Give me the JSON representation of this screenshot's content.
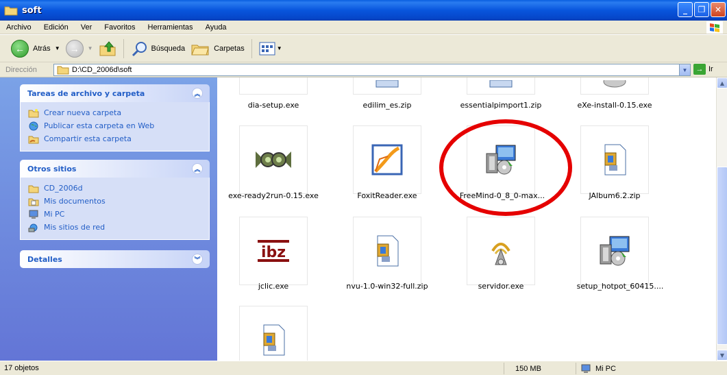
{
  "window": {
    "title": "soft",
    "folder_icon": "folder-icon",
    "buttons": [
      "minimize-icon",
      "restore-icon",
      "close-icon"
    ]
  },
  "menu": [
    "Archivo",
    "Edición",
    "Ver",
    "Favoritos",
    "Herramientas",
    "Ayuda"
  ],
  "toolbar": {
    "back_label": "Atrás",
    "search_label": "Búsqueda",
    "folders_label": "Carpetas"
  },
  "address": {
    "label": "Dirección",
    "path": "D:\\CD_2006d\\soft",
    "go_label": "Ir"
  },
  "left_panel": {
    "tasks": {
      "title": "Tareas de archivo y carpeta",
      "items": [
        "Crear nueva carpeta",
        "Publicar esta carpeta en Web",
        "Compartir esta carpeta"
      ]
    },
    "other_places": {
      "title": "Otros sitios",
      "items": [
        "CD_2006d",
        "Mis documentos",
        "Mi PC",
        "Mis sitios de red"
      ]
    },
    "details": {
      "title": "Detalles"
    }
  },
  "files": [
    {
      "name": "dia-setup.exe",
      "icon": "dia-icon"
    },
    {
      "name": "edilim_es.zip",
      "icon": "zip-icon"
    },
    {
      "name": "essentialpimport1.zip",
      "icon": "zip-icon"
    },
    {
      "name": "eXe-install-0.15.exe",
      "icon": "installer-icon"
    },
    {
      "name": "exe-ready2run-0.15.exe",
      "icon": "exe-ready-icon"
    },
    {
      "name": "FoxitReader.exe",
      "icon": "foxit-icon"
    },
    {
      "name": "FreeMind-0_8_0-max...",
      "icon": "setup-installer-icon"
    },
    {
      "name": "JAlbum6.2.zip",
      "icon": "zip-icon"
    },
    {
      "name": "jclic.exe",
      "icon": "jclic-icon"
    },
    {
      "name": "nvu-1.0-win32-full.zip",
      "icon": "zip-icon"
    },
    {
      "name": "servidor.exe",
      "icon": "server-icon"
    },
    {
      "name": "setup_hotpot_60415....",
      "icon": "setup-installer-icon"
    },
    {
      "name": "",
      "icon": "zip-icon"
    }
  ],
  "status": {
    "count": "17 objetos",
    "size": "150 MB",
    "location": "Mi PC"
  },
  "colors": {
    "highlight_circle": "#e50000",
    "title_bar": "#0855dd",
    "panel_blue": "#7ba2e7"
  }
}
